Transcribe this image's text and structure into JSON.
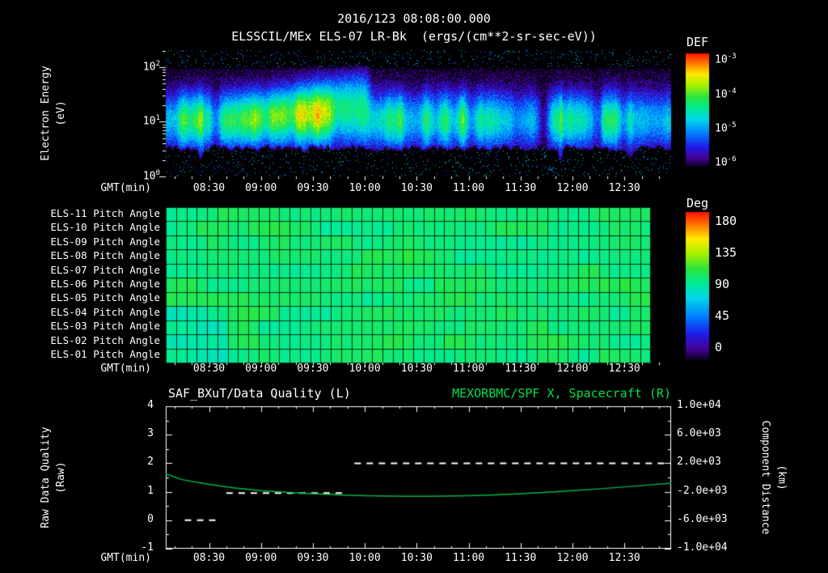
{
  "header": {
    "datetime": "2016/123 08:08:00.000",
    "title": "ELSSCIL/MEx ELS-07 LR-Bk  (ergs/(cm**2-sr-sec-eV))"
  },
  "time_axis": {
    "label": "GMT(min)",
    "ticks": [
      "08:30",
      "09:00",
      "09:30",
      "10:00",
      "10:30",
      "11:00",
      "11:30",
      "12:00",
      "12:30"
    ],
    "range": [
      "08:05",
      "12:57"
    ]
  },
  "spectrogram_panel": {
    "ylabel1": "Electron Energy",
    "ylabel2": "(eV)",
    "yticks": [
      "10^2",
      "10^1",
      "10^0"
    ],
    "colorbar_title": "DEF",
    "colorbar_ticks": [
      "10^-3",
      "10^-4",
      "10^-5",
      "10^-6"
    ]
  },
  "pitch_panel": {
    "row_labels": [
      "ELS-11 Pitch Angle",
      "ELS-10 Pitch Angle",
      "ELS-09 Pitch Angle",
      "ELS-08 Pitch Angle",
      "ELS-07 Pitch Angle",
      "ELS-06 Pitch Angle",
      "ELS-05 Pitch Angle",
      "ELS-04 Pitch Angle",
      "ELS-03 Pitch Angle",
      "ELS-02 Pitch Angle",
      "ELS-01 Pitch Angle"
    ],
    "colorbar_title": "Deg",
    "colorbar_ticks": [
      "180",
      "135",
      "90",
      "45",
      "0"
    ]
  },
  "bottom_panel": {
    "left_title": "SAF_BXuT/Data Quality (L)",
    "right_title": "MEXORBMC/SPF X, Spacecraft (R)",
    "left_ylabel1": "Raw Data Quality",
    "left_ylabel2": "(Raw)",
    "right_ylabel1": "Component Distance",
    "right_ylabel2": "(km)",
    "left_yticks": [
      "4",
      "3",
      "2",
      "1",
      "0",
      "-1"
    ],
    "right_yticks": [
      "1.0e+04",
      "6.0e+03",
      "2.0e+03",
      "-2.0e+03",
      "-6.0e+03",
      "-1.0e+04"
    ]
  },
  "colors": {
    "background": "#000000",
    "text": "#ffffff",
    "accent_green": "#00e14d",
    "curve_green": "#00b548",
    "quality_white": "#ffffff"
  },
  "chart_data": [
    {
      "type": "heatmap",
      "name": "electron_energy_spectrogram",
      "title": "ELSSCIL/MEx ELS-07 LR-Bk",
      "units": "ergs/(cm**2-sr-sec-eV)",
      "x_range": [
        "08:05",
        "12:57"
      ],
      "y_axis": {
        "label": "Electron Energy (eV)",
        "scale": "log",
        "range": [
          1,
          200
        ]
      },
      "color_axis": {
        "label": "DEF",
        "scale": "log",
        "range": [
          1e-06,
          0.001
        ]
      },
      "structure": {
        "main_band": {
          "center_eV": 11,
          "sigma_decades": 0.37,
          "typical_flux_log10": -4.5
        },
        "enhancement": {
          "t_start": "08:40",
          "t_end": "10:00",
          "peak": "09:35",
          "center_eV_start": 11,
          "center_eV_end": 36,
          "peak_flux_log10": -3.5
        },
        "low_energy_cutoff_eV": 4,
        "data_gaps": [
          {
            "t": "08:34",
            "depth": 0.5,
            "width_min": 2.5
          },
          {
            "t": "11:43",
            "depth": 0.75,
            "width_min": 3.5
          },
          {
            "t": "12:14",
            "depth": 0.6,
            "width_min": 4
          }
        ],
        "bright_columns": [
          {
            "t": "08:25",
            "amp": 0.7,
            "width_min": 1.5
          },
          {
            "t": "11:53",
            "amp": 0.5,
            "width_min": 1.5
          },
          {
            "t": "12:33",
            "amp": 0.35,
            "width_min": 2
          }
        ]
      }
    },
    {
      "type": "heatmap",
      "name": "pitch_angle_panels",
      "rows": [
        "ELS-11",
        "ELS-10",
        "ELS-09",
        "ELS-08",
        "ELS-07",
        "ELS-06",
        "ELS-05",
        "ELS-04",
        "ELS-03",
        "ELS-02",
        "ELS-01"
      ],
      "value_range_deg": [
        0,
        180
      ],
      "typical_value_deg": 101,
      "coverage": {
        "t_start": "08:05",
        "t_end": "12:45"
      }
    },
    {
      "type": "line",
      "name": "quality_and_distance",
      "left_axis": {
        "label": "Raw Data Quality (Raw)",
        "range": [
          -1,
          4
        ]
      },
      "right_axis": {
        "label": "Component Distance (km)",
        "range": [
          -10000,
          10000
        ]
      },
      "series": [
        {
          "name": "SAF_BXuT/Data Quality (L)",
          "axis": "left",
          "style": "dashed",
          "color": "#ffffff",
          "segments": [
            {
              "value": 0,
              "t_start": "08:16",
              "t_end": "08:34"
            },
            {
              "value": 0.95,
              "t_start": "08:40",
              "t_end": "09:50"
            },
            {
              "value": 2,
              "t_start": "09:54",
              "t_end": "12:57"
            }
          ]
        },
        {
          "name": "MEXORBMC/SPF X, Spacecraft (R)",
          "axis": "right",
          "style": "solid",
          "color": "#00b548",
          "t": [
            "08:05",
            "08:15",
            "08:30",
            "08:45",
            "09:00",
            "09:15",
            "09:30",
            "09:45",
            "10:00",
            "10:15",
            "10:30",
            "10:45",
            "11:00",
            "11:15",
            "11:30",
            "11:45",
            "12:00",
            "12:15",
            "12:30",
            "12:45",
            "12:57"
          ],
          "km": [
            480,
            -320,
            -960,
            -1480,
            -1840,
            -2080,
            -2280,
            -2440,
            -2560,
            -2620,
            -2640,
            -2620,
            -2560,
            -2440,
            -2280,
            -2080,
            -1840,
            -1600,
            -1320,
            -1040,
            -800
          ]
        }
      ]
    }
  ]
}
